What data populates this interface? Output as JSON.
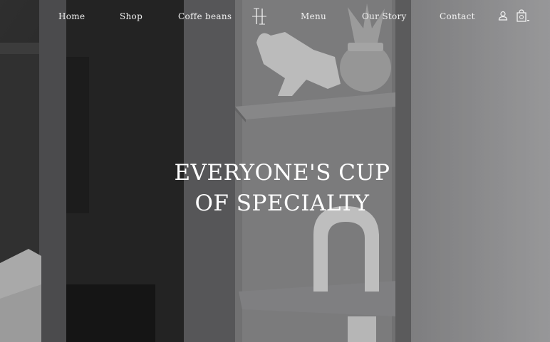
{
  "nav": {
    "items": [
      {
        "id": "home",
        "label": "Home"
      },
      {
        "id": "shop",
        "label": "Shop"
      },
      {
        "id": "coffee-beans",
        "label": "Coffe beans"
      },
      {
        "id": "menu",
        "label": "Menu"
      },
      {
        "id": "our-story",
        "label": "Our Story"
      },
      {
        "id": "contact",
        "label": "Contact"
      }
    ],
    "logo_icon": "monogram-logo-icon",
    "account_icon": "user-icon",
    "cart_icon": "shopping-bag-icon"
  },
  "hero": {
    "headline_line1": "EVERYONE'S CUP",
    "headline_line2": "OF SPECIALTY"
  },
  "colors": {
    "text": "#ffffff",
    "overlay": "#000000"
  }
}
